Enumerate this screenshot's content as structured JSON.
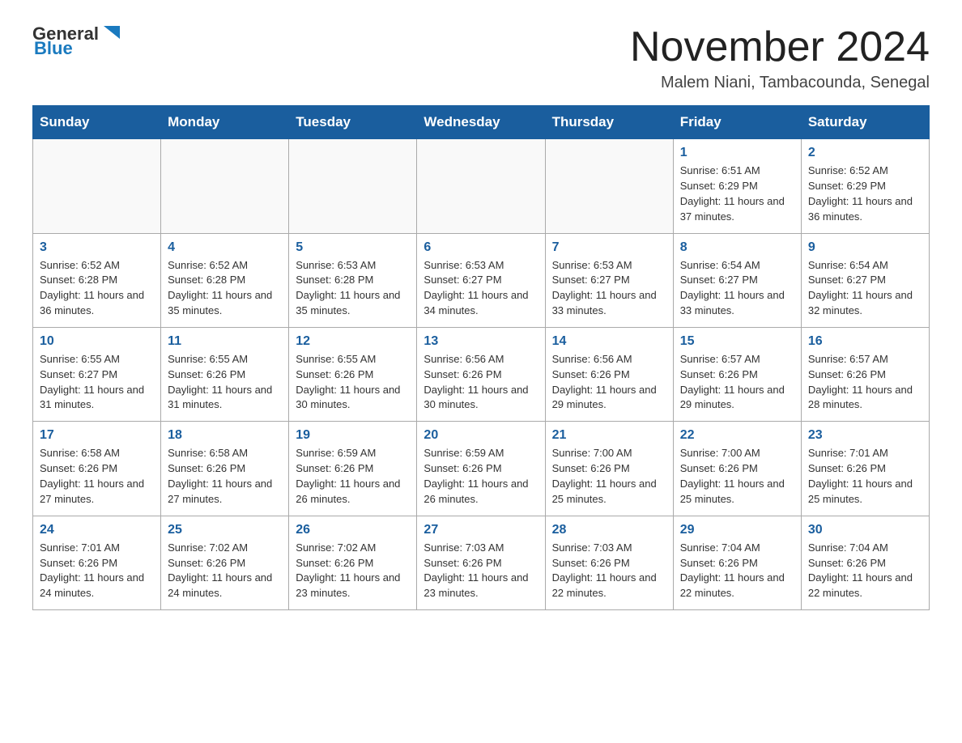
{
  "header": {
    "logo_text_general": "General",
    "logo_text_blue": "Blue",
    "title": "November 2024",
    "subtitle": "Malem Niani, Tambacounda, Senegal"
  },
  "weekdays": [
    "Sunday",
    "Monday",
    "Tuesday",
    "Wednesday",
    "Thursday",
    "Friday",
    "Saturday"
  ],
  "weeks": [
    [
      {
        "day": "",
        "info": ""
      },
      {
        "day": "",
        "info": ""
      },
      {
        "day": "",
        "info": ""
      },
      {
        "day": "",
        "info": ""
      },
      {
        "day": "",
        "info": ""
      },
      {
        "day": "1",
        "info": "Sunrise: 6:51 AM\nSunset: 6:29 PM\nDaylight: 11 hours and 37 minutes."
      },
      {
        "day": "2",
        "info": "Sunrise: 6:52 AM\nSunset: 6:29 PM\nDaylight: 11 hours and 36 minutes."
      }
    ],
    [
      {
        "day": "3",
        "info": "Sunrise: 6:52 AM\nSunset: 6:28 PM\nDaylight: 11 hours and 36 minutes."
      },
      {
        "day": "4",
        "info": "Sunrise: 6:52 AM\nSunset: 6:28 PM\nDaylight: 11 hours and 35 minutes."
      },
      {
        "day": "5",
        "info": "Sunrise: 6:53 AM\nSunset: 6:28 PM\nDaylight: 11 hours and 35 minutes."
      },
      {
        "day": "6",
        "info": "Sunrise: 6:53 AM\nSunset: 6:27 PM\nDaylight: 11 hours and 34 minutes."
      },
      {
        "day": "7",
        "info": "Sunrise: 6:53 AM\nSunset: 6:27 PM\nDaylight: 11 hours and 33 minutes."
      },
      {
        "day": "8",
        "info": "Sunrise: 6:54 AM\nSunset: 6:27 PM\nDaylight: 11 hours and 33 minutes."
      },
      {
        "day": "9",
        "info": "Sunrise: 6:54 AM\nSunset: 6:27 PM\nDaylight: 11 hours and 32 minutes."
      }
    ],
    [
      {
        "day": "10",
        "info": "Sunrise: 6:55 AM\nSunset: 6:27 PM\nDaylight: 11 hours and 31 minutes."
      },
      {
        "day": "11",
        "info": "Sunrise: 6:55 AM\nSunset: 6:26 PM\nDaylight: 11 hours and 31 minutes."
      },
      {
        "day": "12",
        "info": "Sunrise: 6:55 AM\nSunset: 6:26 PM\nDaylight: 11 hours and 30 minutes."
      },
      {
        "day": "13",
        "info": "Sunrise: 6:56 AM\nSunset: 6:26 PM\nDaylight: 11 hours and 30 minutes."
      },
      {
        "day": "14",
        "info": "Sunrise: 6:56 AM\nSunset: 6:26 PM\nDaylight: 11 hours and 29 minutes."
      },
      {
        "day": "15",
        "info": "Sunrise: 6:57 AM\nSunset: 6:26 PM\nDaylight: 11 hours and 29 minutes."
      },
      {
        "day": "16",
        "info": "Sunrise: 6:57 AM\nSunset: 6:26 PM\nDaylight: 11 hours and 28 minutes."
      }
    ],
    [
      {
        "day": "17",
        "info": "Sunrise: 6:58 AM\nSunset: 6:26 PM\nDaylight: 11 hours and 27 minutes."
      },
      {
        "day": "18",
        "info": "Sunrise: 6:58 AM\nSunset: 6:26 PM\nDaylight: 11 hours and 27 minutes."
      },
      {
        "day": "19",
        "info": "Sunrise: 6:59 AM\nSunset: 6:26 PM\nDaylight: 11 hours and 26 minutes."
      },
      {
        "day": "20",
        "info": "Sunrise: 6:59 AM\nSunset: 6:26 PM\nDaylight: 11 hours and 26 minutes."
      },
      {
        "day": "21",
        "info": "Sunrise: 7:00 AM\nSunset: 6:26 PM\nDaylight: 11 hours and 25 minutes."
      },
      {
        "day": "22",
        "info": "Sunrise: 7:00 AM\nSunset: 6:26 PM\nDaylight: 11 hours and 25 minutes."
      },
      {
        "day": "23",
        "info": "Sunrise: 7:01 AM\nSunset: 6:26 PM\nDaylight: 11 hours and 25 minutes."
      }
    ],
    [
      {
        "day": "24",
        "info": "Sunrise: 7:01 AM\nSunset: 6:26 PM\nDaylight: 11 hours and 24 minutes."
      },
      {
        "day": "25",
        "info": "Sunrise: 7:02 AM\nSunset: 6:26 PM\nDaylight: 11 hours and 24 minutes."
      },
      {
        "day": "26",
        "info": "Sunrise: 7:02 AM\nSunset: 6:26 PM\nDaylight: 11 hours and 23 minutes."
      },
      {
        "day": "27",
        "info": "Sunrise: 7:03 AM\nSunset: 6:26 PM\nDaylight: 11 hours and 23 minutes."
      },
      {
        "day": "28",
        "info": "Sunrise: 7:03 AM\nSunset: 6:26 PM\nDaylight: 11 hours and 22 minutes."
      },
      {
        "day": "29",
        "info": "Sunrise: 7:04 AM\nSunset: 6:26 PM\nDaylight: 11 hours and 22 minutes."
      },
      {
        "day": "30",
        "info": "Sunrise: 7:04 AM\nSunset: 6:26 PM\nDaylight: 11 hours and 22 minutes."
      }
    ]
  ]
}
